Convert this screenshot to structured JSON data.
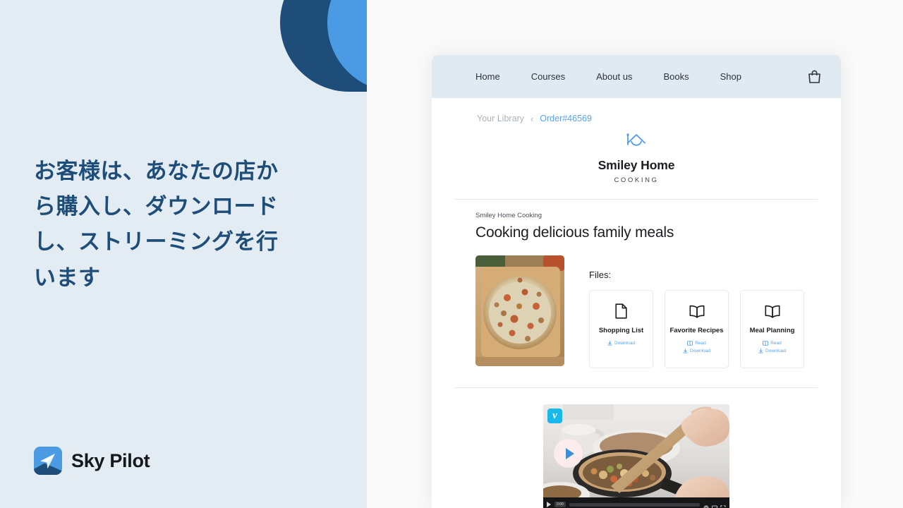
{
  "left": {
    "headline": "お客様は、あなたの店から購入し、ダウンロードし、ストリーミングを行います",
    "brand_name": "Sky Pilot",
    "brand_logo_icon": "paper-plane-icon",
    "bg_color": "#e3ecf2",
    "deco_dark_color": "#1d4d78",
    "deco_light_color": "#4a9ae4",
    "headline_color": "#1d4d78"
  },
  "browser": {
    "nav": {
      "items": [
        {
          "label": "Home"
        },
        {
          "label": "Courses"
        },
        {
          "label": "About us"
        },
        {
          "label": "Books"
        },
        {
          "label": "Shop"
        }
      ],
      "cart_icon": "shopping-bag-icon",
      "bg_color": "#e1eaf1"
    },
    "breadcrumb": {
      "parent": "Your Library",
      "separator": "‹",
      "current": "Order#46569",
      "link_color": "#5ba3e8"
    },
    "store": {
      "logo_icon": "smiley-house-icon",
      "name": "Smiley Home",
      "tagline": "COOKING",
      "icon_color": "#4a9ae4"
    },
    "product": {
      "kicker": "Smiley Home Cooking",
      "title": "Cooking delicious family meals",
      "image_alt": "pizza-on-wooden-board"
    },
    "files": {
      "label": "Files:",
      "cards": [
        {
          "name": "Shopping List",
          "icon": "document-icon",
          "actions": [
            {
              "label": "Download",
              "icon": "download-icon"
            }
          ]
        },
        {
          "name": "Favorite Recipes",
          "icon": "book-icon",
          "actions": [
            {
              "label": "Read",
              "icon": "book-open-icon"
            },
            {
              "label": "Download",
              "icon": "download-icon"
            }
          ]
        },
        {
          "name": "Meal Planning",
          "icon": "book-icon",
          "actions": [
            {
              "label": "Read",
              "icon": "book-open-icon"
            },
            {
              "label": "Download",
              "icon": "download-icon"
            }
          ]
        }
      ]
    },
    "video": {
      "provider_badge": "v",
      "provider": "vimeo-logo",
      "play_icon": "play-button-icon",
      "time": "0:00",
      "controls": {
        "play_icon": "play-icon",
        "settings_icon": "gear-icon",
        "pip_icon": "picture-in-picture-icon",
        "fullscreen_icon": "fullscreen-icon"
      },
      "thumbnail_alt": "hand-stirring-pan-with-wooden-spatula"
    }
  }
}
